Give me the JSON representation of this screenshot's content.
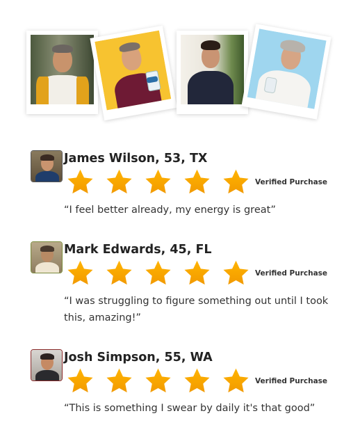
{
  "photos": [
    {
      "name": "photo-man-yellow-scarf"
    },
    {
      "name": "photo-man-holding-bottle"
    },
    {
      "name": "photo-man-plants"
    },
    {
      "name": "photo-man-white-tee"
    }
  ],
  "reviews": [
    {
      "name": "James Wilson, 53, TX",
      "rating": 5,
      "verified": "Verified Purchase",
      "quote": "“I feel better already, my energy is great”"
    },
    {
      "name": "Mark Edwards, 45, FL",
      "rating": 5,
      "verified": "Verified Purchase",
      "quote": "“I was struggling to figure something out until I took this, amazing!”"
    },
    {
      "name": "Josh Simpson, 55, WA",
      "rating": 5,
      "verified": "Verified Purchase",
      "quote": "“This is something I swear by daily it's that good”"
    }
  ],
  "colors": {
    "star": "#ffb400",
    "star_dark": "#f29a00",
    "photo_yellow": "#f7c330",
    "photo_blue": "#9fd6ef"
  }
}
